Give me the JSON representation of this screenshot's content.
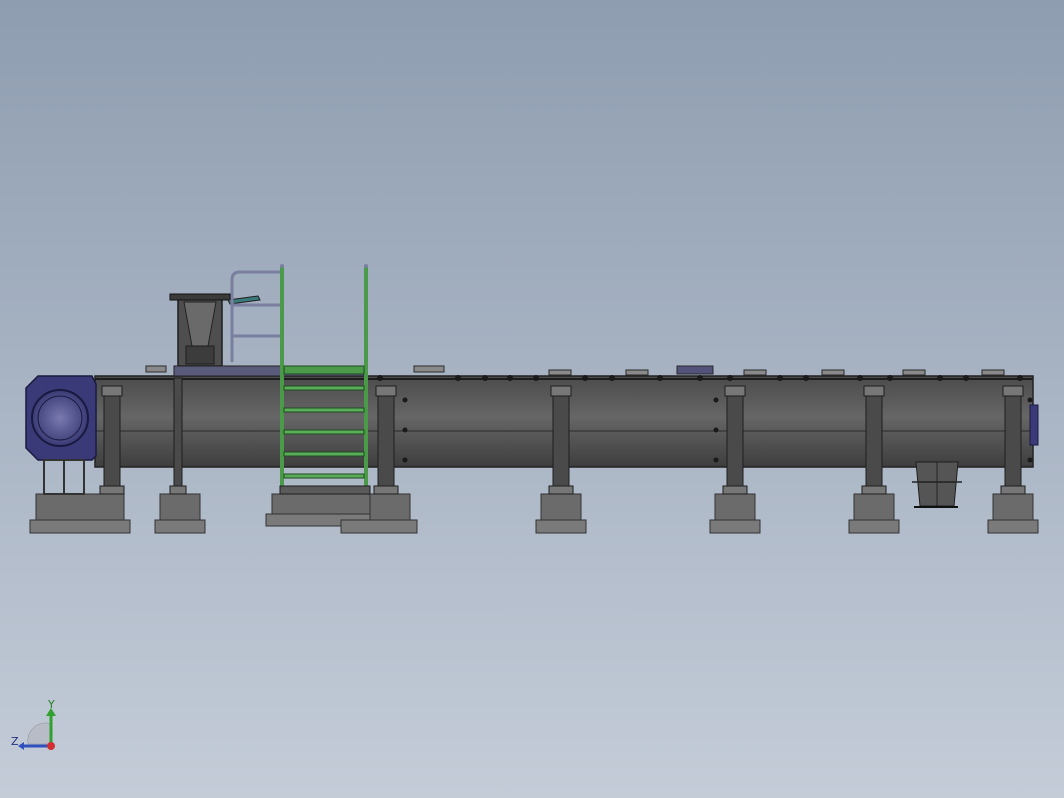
{
  "axes_triad": {
    "y_label": "Y",
    "z_label": "Z"
  },
  "colors": {
    "background_top": "#8e9db0",
    "background_bottom": "#c4ccd8",
    "conveyor_body": "#555555",
    "end_cap": "#3a3a78",
    "stair": "#4a9a4a",
    "railing": "#7a7fa0",
    "foundation": "#6e6e6e",
    "axis_x": "#d03030",
    "axis_y": "#30a030",
    "axis_z": "#3050c0"
  },
  "model": {
    "component": "screw-conveyor-assembly",
    "view": "front"
  }
}
